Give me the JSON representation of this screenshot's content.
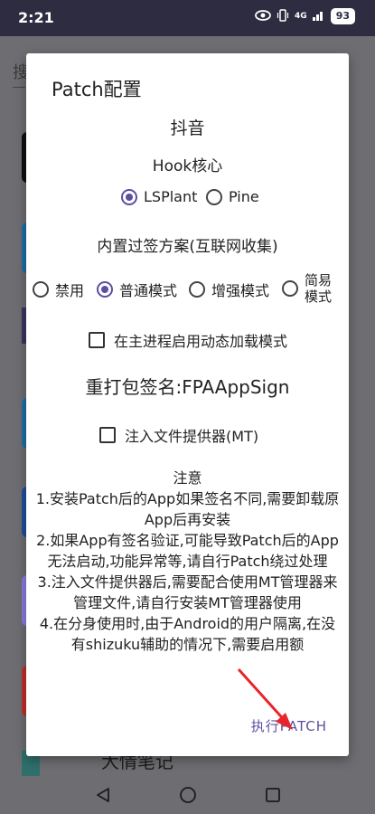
{
  "status_bar": {
    "time": "2:21",
    "network": "4G",
    "battery": "93"
  },
  "background": {
    "search_hint": "搜",
    "bottom_item_text": "大情笔记"
  },
  "dialog": {
    "title": "Patch配置",
    "app_name": "抖音",
    "hook_section": {
      "title": "Hook核心",
      "options": [
        {
          "label": "LSPlant",
          "selected": true
        },
        {
          "label": "Pine",
          "selected": false
        }
      ]
    },
    "signature_section": {
      "title": "内置过签方案(互联网收集)",
      "options": [
        {
          "label": "禁用",
          "selected": false
        },
        {
          "label": "普通模式",
          "selected": true
        },
        {
          "label": "增强模式",
          "selected": false
        },
        {
          "label": "简易模式",
          "selected": false
        }
      ]
    },
    "dynamic_load_checkbox": {
      "label": "在主进程启用动态加载模式",
      "checked": false
    },
    "repack_signature": "重打包签名:FPAAppSign",
    "inject_checkbox": {
      "label": "注入文件提供器(MT)",
      "checked": false
    },
    "notes": {
      "title": "注意",
      "items": [
        "1.安装Patch后的App如果签名不同,需要卸载原App后再安装",
        "2.如果App有签名验证,可能导致Patch后的App无法启动,功能异常等,请自行Patch绕过处理",
        "3.注入文件提供器后,需要配合使用MT管理器来管理文件,请自行安装MT管理器使用",
        "4.在分身使用时,由于Android的用户隔离,在没有shizuku辅助的情况下,需要启用额"
      ]
    },
    "execute_button": "执行PATCH"
  },
  "colors": {
    "accent": "#5b4fa2",
    "status_bar": "#2e2c40",
    "scrim": "#6e6e72",
    "annotation_arrow": "#e8252a"
  }
}
